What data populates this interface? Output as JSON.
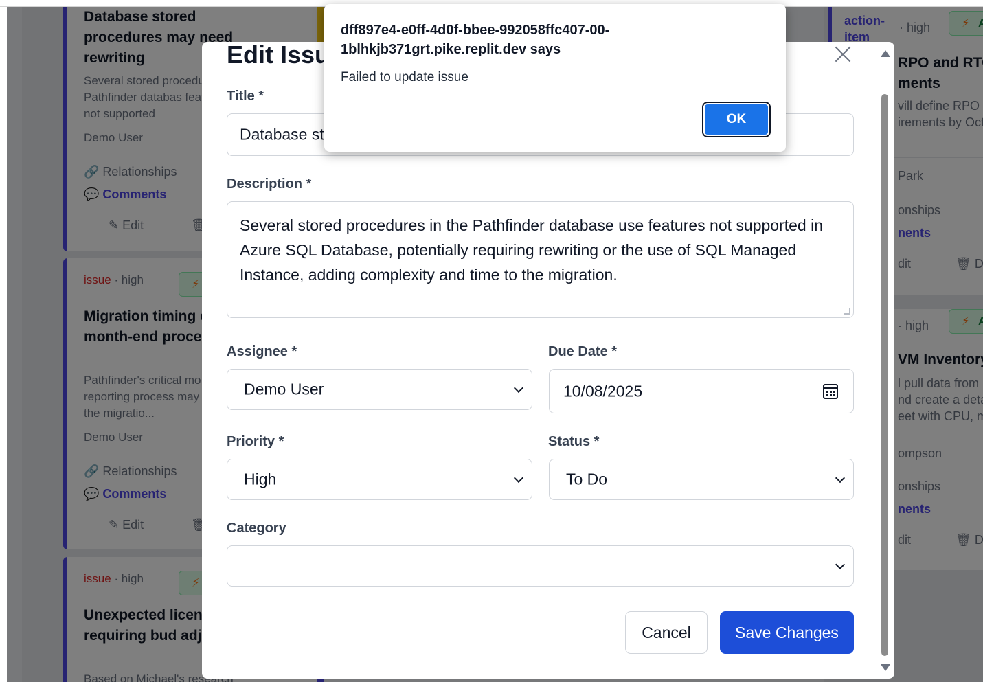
{
  "board": {
    "left_cards": [
      {
        "type": "",
        "priority": "",
        "title": "Database stored procedures may need rewriting",
        "description": "Several stored procedu the Pathfinder databas features not supported",
        "owner": "Demo User",
        "relationships": "Relationships",
        "comments": "Comments",
        "edit": "Edit"
      },
      {
        "type": "issue",
        "priority": "· high",
        "title": "Migration timing c with month-end processing",
        "description": "Pathfinder's critical mo reporting process may with the migratio...",
        "owner": "Demo User",
        "relationships": "Relationships",
        "comments": "Comments",
        "edit": "Edit"
      },
      {
        "type": "issue",
        "priority": "· high",
        "title": "Unexpected licensi costs requiring bud adjustment",
        "description": "Based on Michael's research",
        "owner": "",
        "relationships": "",
        "comments": "",
        "edit": ""
      }
    ],
    "right_cards": [
      {
        "type": "action-item",
        "priority": "· high",
        "badge": "AI",
        "title1": "RPO and RTO",
        "title2": "ments",
        "desc1": "vill define RPO a",
        "desc2": "irements by Octo",
        "owner": "Park",
        "relationships": "onships",
        "comments": "nents",
        "edit": "dit",
        "delete": "De"
      },
      {
        "priority": "· high",
        "badge": "AI",
        "title1": "VM Inventory",
        "desc1": "l pull data from",
        "desc2": "nd create a deta",
        "desc3": "eet with CPU, me",
        "owner": "ompson",
        "relationships": "onships",
        "comments": "nents",
        "edit": "dit",
        "delete": "De"
      }
    ]
  },
  "modal": {
    "title": "Edit Issue",
    "fields": {
      "title_label": "Title *",
      "title_value": "Database st",
      "description_label": "Description *",
      "description_value": "Several stored procedures in the Pathfinder database use features not supported in Azure SQL Database, potentially requiring rewriting or the use of SQL Managed Instance, adding complexity and time to the migration.",
      "assignee_label": "Assignee *",
      "assignee_value": "Demo User",
      "due_date_label": "Due Date *",
      "due_date_value": "10/08/2025",
      "priority_label": "Priority *",
      "priority_value": "High",
      "status_label": "Status *",
      "status_value": "To Do",
      "category_label": "Category",
      "category_value": ""
    },
    "cancel_label": "Cancel",
    "save_label": "Save Changes"
  },
  "alert": {
    "origin": "dff897e4-e0ff-4d0f-bbee-992058ffc407-00-1blhkjb371grt.pike.replit.dev says",
    "message": "Failed to update issue",
    "ok_label": "OK"
  },
  "colors": {
    "accent": "#4f46e5",
    "primary_button": "#1d4ed8",
    "issue_type": "#dc2626",
    "alert_ok": "#1a73e8"
  }
}
